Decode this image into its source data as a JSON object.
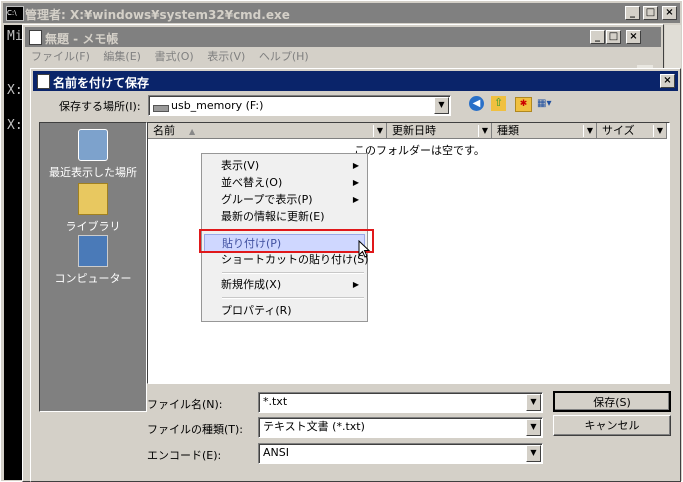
{
  "cmd": {
    "title": "管理者: X:¥windows¥system32¥cmd.exe",
    "icon": "cmd-icon",
    "lines": [
      "Mi",
      "X:",
      "X:"
    ]
  },
  "notepad": {
    "title": "無題 - メモ帳",
    "menu": [
      "ファイル(F)",
      "編集(E)",
      "書式(O)",
      "表示(V)",
      "ヘルプ(H)"
    ]
  },
  "dialog": {
    "title": "名前を付けて保存",
    "location_label": "保存する場所(I):",
    "location_value": "usb_memory (F:)",
    "places": [
      "最近表示した場所",
      "ライブラリ",
      "コンピューター"
    ],
    "columns": [
      "名前",
      "更新日時",
      "種類",
      "サイズ"
    ],
    "empty_text": "このフォルダーは空です。",
    "filename_label": "ファイル名(N):",
    "filename_value": "*.txt",
    "filetype_label": "ファイルの種類(T):",
    "filetype_value": "テキスト文書 (*.txt)",
    "encoding_label": "エンコード(E):",
    "encoding_value": "ANSI",
    "save_button": "保存(S)",
    "cancel_button": "キャンセル"
  },
  "context_menu": {
    "items": [
      {
        "label": "表示(V)",
        "submenu": true
      },
      {
        "label": "並べ替え(O)",
        "submenu": true
      },
      {
        "label": "グループで表示(P)",
        "submenu": true
      },
      {
        "label": "最新の情報に更新(E)",
        "submenu": false
      },
      {
        "label": "貼り付け(P)",
        "submenu": false,
        "highlighted": true
      },
      {
        "label": "ショートカットの貼り付け(S)",
        "submenu": false
      },
      {
        "label": "新規作成(X)",
        "submenu": true
      },
      {
        "label": "プロパティ(R)",
        "submenu": false
      }
    ]
  },
  "colors": {
    "title_active": "#0a246a",
    "title_inactive": "#808080",
    "highlight_box": "#e0181a",
    "places_bg": "#808080"
  }
}
